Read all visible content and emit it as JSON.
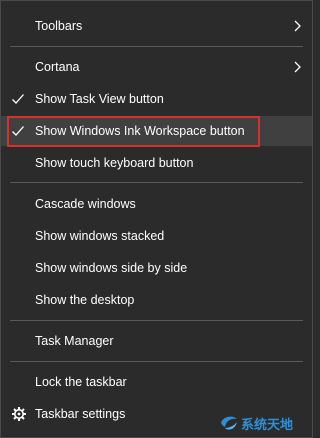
{
  "menu": {
    "toolbars": "Toolbars",
    "cortana": "Cortana",
    "show_task_view": "Show Task View button",
    "show_ink_workspace": "Show Windows Ink Workspace button",
    "show_touch_keyboard": "Show touch keyboard button",
    "cascade": "Cascade windows",
    "stacked": "Show windows stacked",
    "side_by_side": "Show windows side by side",
    "show_desktop": "Show the desktop",
    "task_manager": "Task Manager",
    "lock_taskbar": "Lock the taskbar",
    "taskbar_settings": "Taskbar settings"
  },
  "checked_items": [
    "show_task_view",
    "show_ink_workspace"
  ],
  "highlight_color": "#d9302b",
  "icons": {
    "check": "check-icon",
    "chevron": "chevron-right-icon",
    "settings": "gear-icon"
  },
  "watermark_text": "系统天地"
}
